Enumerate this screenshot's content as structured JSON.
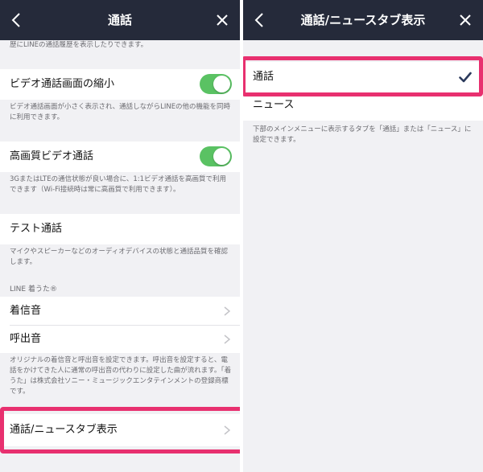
{
  "left": {
    "nav": {
      "title": "通話"
    },
    "top_note": "歴にLINEの通話履歴を表示したりできます。",
    "video_shrink": {
      "label": "ビデオ通話画面の縮小",
      "enabled": true,
      "note": "ビデオ通話画面が小さく表示され、通話しながらLINEの他の機能を同時に利用できます。"
    },
    "hd_video": {
      "label": "高画質ビデオ通話",
      "enabled": true,
      "note": "3GまたはLTEの通信状態が良い場合に、1:1ビデオ通話を高画質で利用できます（Wi-Fi接続時は常に高画質で利用できます）。"
    },
    "test_call": {
      "label": "テスト通話",
      "note": "マイクやスピーカーなどのオーディオデバイスの状態と通話品質を確認します。"
    },
    "chaku_uta": {
      "header": "LINE 着うた®",
      "items": [
        {
          "label": "着信音"
        },
        {
          "label": "呼出音"
        }
      ],
      "note": "オリジナルの着信音と呼出音を設定できます。呼出音を設定すると、電話をかけてきた人に通常の呼出音の代わりに設定した曲が流れます。「着うた」は株式会社ソニー・ミュージックエンタテインメントの登録商標です。"
    },
    "tab_display": {
      "label": "通話/ニュースタブ表示"
    }
  },
  "right": {
    "nav": {
      "title": "通話/ニュースタブ表示"
    },
    "options": [
      {
        "label": "通話",
        "selected": true
      },
      {
        "label": "ニュース",
        "selected": false
      }
    ],
    "note": "下部のメインメニューに表示するタブを「通話」または「ニュース」に設定できます。"
  },
  "colors": {
    "navbar": "#252a3a",
    "toggle_on": "#5ac263",
    "highlight": "#e8306f",
    "check": "#2b3a5c",
    "background": "#f1f1f4"
  },
  "icons": {
    "back": "chevron-left-icon",
    "close": "close-icon",
    "disclosure": "chevron-right-icon",
    "selected": "checkmark-icon"
  }
}
